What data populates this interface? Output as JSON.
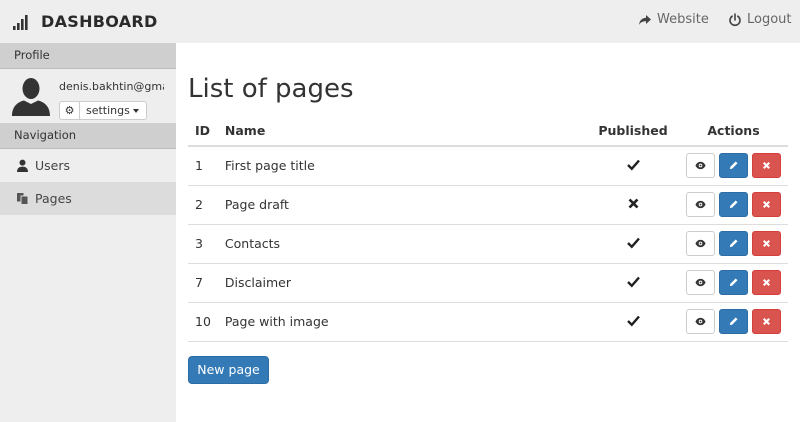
{
  "header": {
    "icon": "signal-bars-icon",
    "title": "DASHBOARD",
    "links": [
      {
        "label": "Website",
        "icon": "share-arrow-icon"
      },
      {
        "label": "Logout",
        "icon": "power-icon"
      }
    ]
  },
  "sidebar": {
    "profile_header": "Profile",
    "user_email": "denis.bakhtin@gma",
    "settings_label": "settings",
    "navigation_header": "Navigation",
    "nav_items": [
      {
        "label": "Users",
        "icon": "user-icon",
        "active": false
      },
      {
        "label": "Pages",
        "icon": "pages-icon",
        "active": true
      }
    ]
  },
  "main": {
    "title": "List of pages",
    "columns": {
      "id": "ID",
      "name": "Name",
      "published": "Published",
      "actions": "Actions"
    },
    "rows": [
      {
        "id": "1",
        "name": "First page title",
        "published": true
      },
      {
        "id": "2",
        "name": "Page draft",
        "published": false
      },
      {
        "id": "3",
        "name": "Contacts",
        "published": true
      },
      {
        "id": "7",
        "name": "Disclaimer",
        "published": true
      },
      {
        "id": "10",
        "name": "Page with image",
        "published": true
      }
    ],
    "new_button_label": "New page"
  },
  "colors": {
    "primary": "#337ab7",
    "danger": "#d9534f",
    "sidebar_bg": "#eeeeee",
    "topbar_bg": "#eeeeee"
  }
}
